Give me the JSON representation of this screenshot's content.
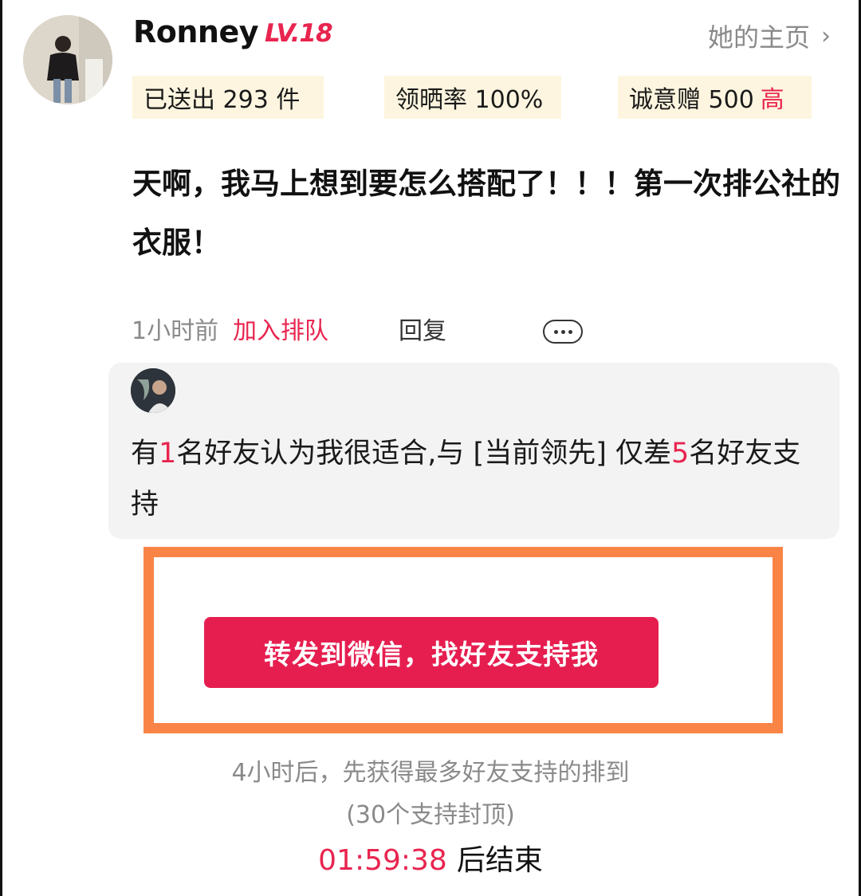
{
  "user": {
    "name": "Ronney",
    "level": "LV.18",
    "homepage_label": "她的主页"
  },
  "stats": [
    {
      "label": "已送出 293 件"
    },
    {
      "label": "领晒率 100%"
    },
    {
      "label": "诚意赠 500",
      "tag": "高"
    }
  ],
  "comment": {
    "text": "天啊，我马上想到要怎么搭配了！！！第一次排公社的衣服！",
    "time": "1小时前",
    "join_label": "加入排队",
    "reply_label": "回复"
  },
  "friend_support": {
    "part1": "有",
    "count": "1",
    "part2": "名好友认为我很适合,与 [当前领先] 仅差",
    "gap": "5",
    "part3": "名好友支持"
  },
  "share_button_label": "转发到微信，找好友支持我",
  "rules": {
    "line1": "4小时后，先获得最多好友支持的排到",
    "line2": "(30个支持封顶)"
  },
  "countdown": {
    "time": "01:59:38",
    "suffix": "后结束"
  },
  "colors": {
    "accent": "#e8254f",
    "button": "#e61e50",
    "stat_bg": "#fdf5df",
    "highlight_border": "#f98446"
  }
}
